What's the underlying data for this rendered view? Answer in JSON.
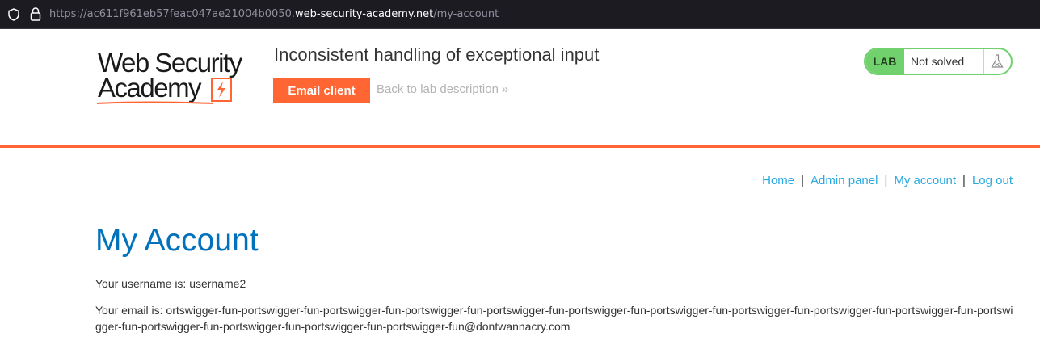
{
  "browser": {
    "url_prefix": "https://ac611f961eb57feac047ae21004b0050.",
    "url_domain": "web-security-academy.net",
    "url_path": "/my-account"
  },
  "header": {
    "logo_line1": "Web Security",
    "logo_line2": "Academy",
    "lab_title": "Inconsistent handling of exceptional input",
    "email_client_label": "Email client",
    "back_link_label": "Back to lab description",
    "back_link_chevron": "»",
    "lab_tag": "LAB",
    "lab_status": "Not solved",
    "accent_color": "#ff6633",
    "status_color": "#70d16d"
  },
  "nav": {
    "home": "Home",
    "admin": "Admin panel",
    "account": "My account",
    "logout": "Log out",
    "separator": "|"
  },
  "main": {
    "title": "My Account",
    "username_line": "Your username is: username2",
    "email_line": "Your email is: ortswigger-fun-portswigger-fun-portswigger-fun-portswigger-fun-portswigger-fun-portswigger-fun-portswigger-fun-portswigger-fun-portswigger-fun-portswigger-fun-portswigger-fun-portswigger-fun-portswigger-fun-portswigger-fun-portswigger-fun@dontwannacry.com"
  }
}
